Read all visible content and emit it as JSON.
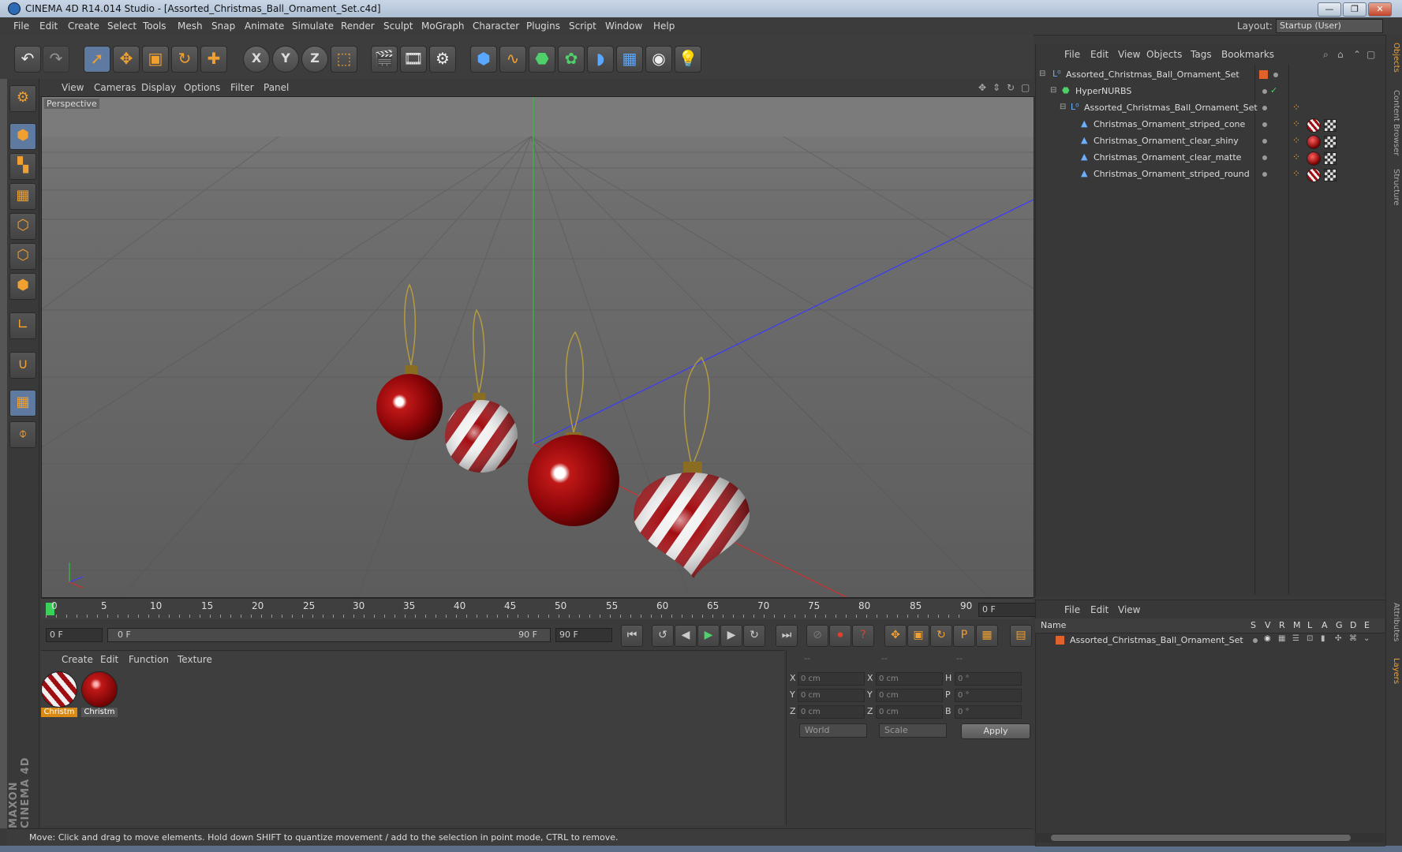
{
  "window": {
    "title": "CINEMA 4D R14.014 Studio - [Assorted_Christmas_Ball_Ornament_Set.c4d]",
    "min": "—",
    "max": "❐",
    "close": "✕"
  },
  "menubar": {
    "items": [
      "File",
      "Edit",
      "Create",
      "Select",
      "Tools",
      "Mesh",
      "Snap",
      "Animate",
      "Simulate",
      "Render",
      "Sculpt",
      "MoGraph",
      "Character",
      "Plugins",
      "Script",
      "Window",
      "Help"
    ],
    "layout_label": "Layout:",
    "layout_value": "Startup (User)"
  },
  "viewport": {
    "menu": [
      "View",
      "Cameras",
      "Display",
      "Options",
      "Filter",
      "Panel"
    ],
    "label": "Perspective"
  },
  "timeline": {
    "ticks": [
      "0",
      "5",
      "10",
      "15",
      "20",
      "25",
      "30",
      "35",
      "40",
      "45",
      "50",
      "55",
      "60",
      "65",
      "70",
      "75",
      "80",
      "85",
      "90"
    ],
    "current_frame": "0 F",
    "start_field": "0 F",
    "range_start": "0 F",
    "range_end": "90 F",
    "end_field": "90 F"
  },
  "materials": {
    "menu": [
      "Create",
      "Edit",
      "Function",
      "Texture"
    ],
    "items": [
      {
        "label": "Christm"
      },
      {
        "label": "Christm"
      }
    ]
  },
  "coords": {
    "col_headers": [
      "--",
      "--",
      "--"
    ],
    "rows": [
      {
        "a": "X",
        "av": "0 cm",
        "b": "X",
        "bv": "0 cm",
        "c": "H",
        "cv": "0 °"
      },
      {
        "a": "Y",
        "av": "0 cm",
        "b": "Y",
        "bv": "0 cm",
        "c": "P",
        "cv": "0 °"
      },
      {
        "a": "Z",
        "av": "0 cm",
        "b": "Z",
        "bv": "0 cm",
        "c": "B",
        "cv": "0 °"
      }
    ],
    "world": "World",
    "scale": "Scale",
    "apply": "Apply"
  },
  "status": "Move: Click and drag to move elements. Hold down SHIFT to quantize movement / add to the selection in point mode, CTRL to remove.",
  "objects": {
    "menu": [
      "File",
      "Edit",
      "View",
      "Objects",
      "Tags",
      "Bookmarks"
    ],
    "rows": [
      {
        "name": "Assorted_Christmas_Ball_Ornament_Set",
        "indent": 0
      },
      {
        "name": "HyperNURBS",
        "indent": 1
      },
      {
        "name": "Assorted_Christmas_Ball_Ornament_Set",
        "indent": 2
      },
      {
        "name": "Christmas_Ornament_striped_cone",
        "indent": 3
      },
      {
        "name": "Christmas_Ornament_clear_shiny",
        "indent": 3
      },
      {
        "name": "Christmas_Ornament_clear_matte",
        "indent": 3
      },
      {
        "name": "Christmas_Ornament_striped_round",
        "indent": 3
      }
    ]
  },
  "layers": {
    "menu": [
      "File",
      "Edit",
      "View"
    ],
    "headers": [
      "Name",
      "S",
      "V",
      "R",
      "M",
      "L",
      "A",
      "G",
      "D",
      "E"
    ],
    "row": "Assorted_Christmas_Ball_Ornament_Set"
  },
  "right_tabs": [
    "Objects",
    "Content Browser",
    "Structure",
    "Attributes",
    "Layers"
  ],
  "brand": "MAXON CINEMA 4D",
  "colors": {
    "accent": "#f0a030",
    "ornament_red": "#8b0000",
    "timeline_marker": "#3ad05a"
  }
}
